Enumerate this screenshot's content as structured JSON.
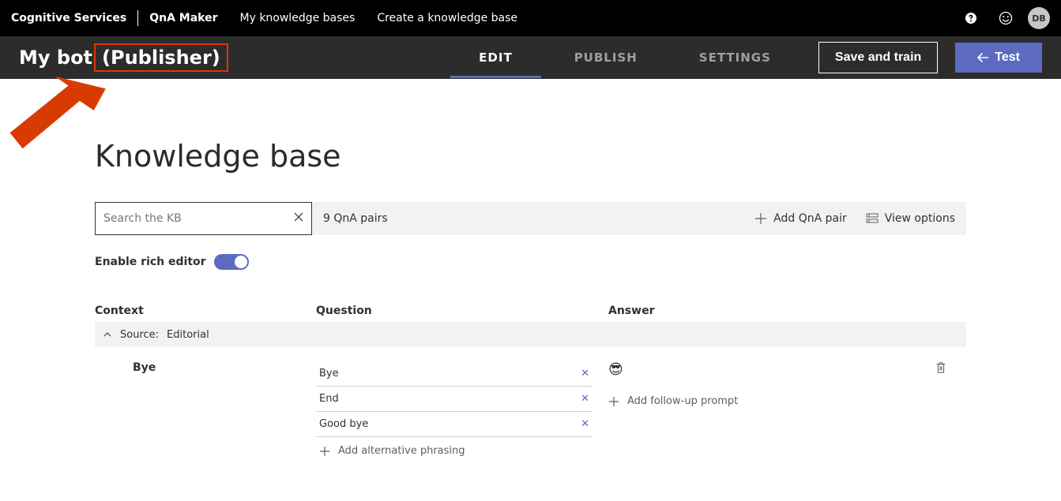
{
  "topbar": {
    "brand": "Cognitive Services",
    "product": "QnA Maker",
    "nav": [
      "My knowledge bases",
      "Create a knowledge base"
    ],
    "avatar_initials": "DB"
  },
  "subbar": {
    "kb_name": "My bot",
    "role": "(Publisher)",
    "tabs": [
      "EDIT",
      "PUBLISH",
      "SETTINGS"
    ],
    "active_tab": 0,
    "save_train_label": "Save and train",
    "test_label": "Test"
  },
  "page_title": "Knowledge base",
  "search": {
    "placeholder": "Search the KB"
  },
  "toolbar": {
    "pair_count_label": "9 QnA pairs",
    "add_pair_label": "Add QnA pair",
    "view_options_label": "View options"
  },
  "rich_editor_label": "Enable rich editor",
  "columns": {
    "context": "Context",
    "question": "Question",
    "answer": "Answer"
  },
  "source": {
    "prefix": "Source:",
    "name": "Editorial"
  },
  "row": {
    "context": "Bye",
    "questions": [
      "Bye",
      "End",
      "Good bye"
    ],
    "answer_emoji": "😎",
    "add_alt_label": "Add alternative phrasing",
    "add_follow_label": "Add follow-up prompt"
  }
}
